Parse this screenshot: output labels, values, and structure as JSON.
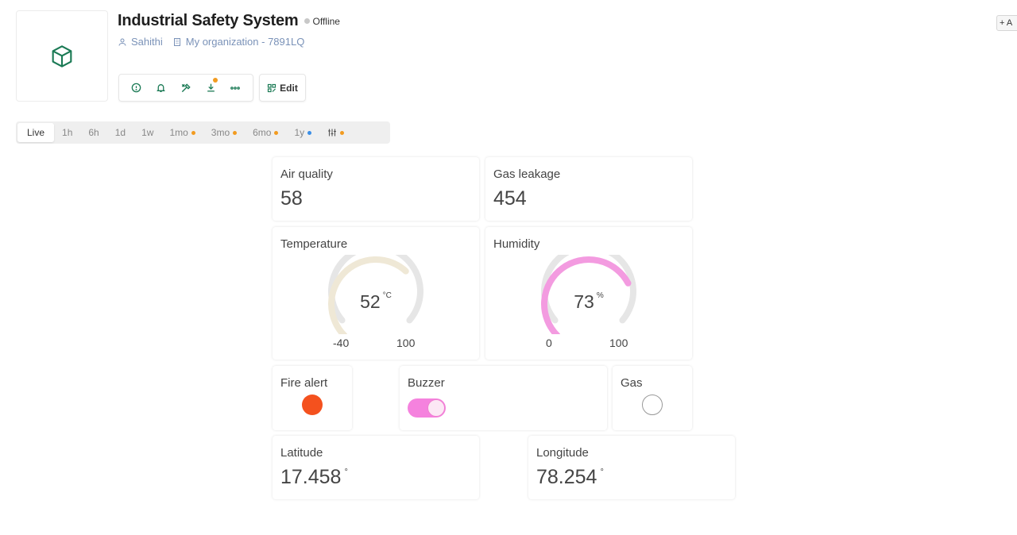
{
  "device": {
    "title": "Industrial Safety System",
    "status": "Offline",
    "owner": "Sahithi",
    "organization": "My organization - 7891LQ",
    "edit_label": "Edit",
    "add_label": "+ A"
  },
  "time_ranges": [
    {
      "label": "Live",
      "active": true,
      "dot": null
    },
    {
      "label": "1h",
      "active": false,
      "dot": null
    },
    {
      "label": "6h",
      "active": false,
      "dot": null
    },
    {
      "label": "1d",
      "active": false,
      "dot": null
    },
    {
      "label": "1w",
      "active": false,
      "dot": null
    },
    {
      "label": "1mo",
      "active": false,
      "dot": "orange"
    },
    {
      "label": "3mo",
      "active": false,
      "dot": "orange"
    },
    {
      "label": "6mo",
      "active": false,
      "dot": "orange"
    },
    {
      "label": "1y",
      "active": false,
      "dot": "blue"
    }
  ],
  "widgets": {
    "air_quality": {
      "label": "Air quality",
      "value": "58"
    },
    "gas_leakage": {
      "label": "Gas leakage",
      "value": "454"
    },
    "temperature": {
      "label": "Temperature",
      "value": "52",
      "unit": "°C",
      "min": "-40",
      "max": "100",
      "color": "#efe8d6",
      "track": "#e6e6e6"
    },
    "humidity": {
      "label": "Humidity",
      "value": "73",
      "unit": "%",
      "min": "0",
      "max": "100",
      "color": "#f39be0",
      "track": "#e6e6e6"
    },
    "fire_alert": {
      "label": "Fire alert",
      "state": "on",
      "color": "#f4511e"
    },
    "buzzer": {
      "label": "Buzzer",
      "state": "on",
      "color": "#f582de"
    },
    "gas": {
      "label": "Gas",
      "state": "off"
    },
    "latitude": {
      "label": "Latitude",
      "value": "17.458",
      "unit": "°"
    },
    "longitude": {
      "label": "Longitude",
      "value": "78.254",
      "unit": "°"
    }
  },
  "colors": {
    "accent": "#1b7a55",
    "meta": "#7a92b8",
    "status_dot": "#c8c8c8",
    "notif_dot": "#f29b20"
  }
}
